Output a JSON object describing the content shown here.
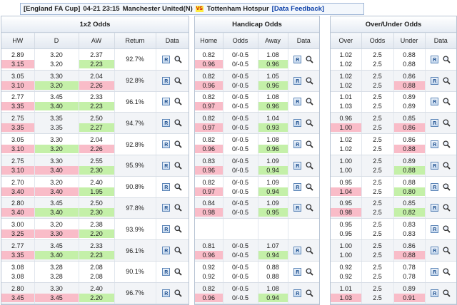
{
  "header": {
    "league": "[England FA Cup]",
    "datetime": "04-21 23:15",
    "home_team": "Manchester United(N)",
    "vs_label": "VS",
    "away_team": "Tottenham Hotspur",
    "feedback_link": "[Data Feedback]"
  },
  "panels": {
    "odds_1x2": {
      "title": "1x2 Odds",
      "columns": [
        "HW",
        "D",
        "AW",
        "Return",
        "Data"
      ],
      "rows": [
        {
          "hw": [
            "2.89",
            "3.15"
          ],
          "d": [
            "3.20",
            "3.20"
          ],
          "aw": [
            "2.37",
            "2.23"
          ],
          "ret": "92.7%",
          "hl": [
            "up",
            "",
            "down"
          ]
        },
        {
          "hw": [
            "3.05",
            "3.10"
          ],
          "d": [
            "3.30",
            "3.20"
          ],
          "aw": [
            "2.04",
            "2.26"
          ],
          "ret": "92.8%",
          "hl": [
            "up",
            "down",
            "up"
          ]
        },
        {
          "hw": [
            "2.77",
            "3.35"
          ],
          "d": [
            "3.45",
            "3.40"
          ],
          "aw": [
            "2.33",
            "2.23"
          ],
          "ret": "96.1%",
          "hl": [
            "up",
            "down",
            "down"
          ]
        },
        {
          "hw": [
            "2.75",
            "3.35"
          ],
          "d": [
            "3.35",
            "3.35"
          ],
          "aw": [
            "2.50",
            "2.27"
          ],
          "ret": "94.7%",
          "hl": [
            "up",
            "",
            "down"
          ]
        },
        {
          "hw": [
            "3.05",
            "3.10"
          ],
          "d": [
            "3.30",
            "3.20"
          ],
          "aw": [
            "2.04",
            "2.26"
          ],
          "ret": "92.8%",
          "hl": [
            "up",
            "down",
            "up"
          ]
        },
        {
          "hw": [
            "2.75",
            "3.10"
          ],
          "d": [
            "3.30",
            "3.40"
          ],
          "aw": [
            "2.55",
            "2.30"
          ],
          "ret": "95.9%",
          "hl": [
            "up",
            "up",
            "down"
          ]
        },
        {
          "hw": [
            "2.70",
            "3.40"
          ],
          "d": [
            "3.20",
            "3.40"
          ],
          "aw": [
            "2.40",
            "1.95"
          ],
          "ret": "90.8%",
          "hl": [
            "up",
            "up",
            "down"
          ]
        },
        {
          "hw": [
            "2.80",
            "3.40"
          ],
          "d": [
            "3.45",
            "3.40"
          ],
          "aw": [
            "2.50",
            "2.30"
          ],
          "ret": "97.8%",
          "hl": [
            "up",
            "down",
            "down"
          ]
        },
        {
          "hw": [
            "3.00",
            "3.25"
          ],
          "d": [
            "3.20",
            "3.30"
          ],
          "aw": [
            "2.38",
            "2.20"
          ],
          "ret": "93.9%",
          "hl": [
            "up",
            "up",
            "down"
          ]
        },
        {
          "hw": [
            "2.77",
            "3.35"
          ],
          "d": [
            "3.45",
            "3.40"
          ],
          "aw": [
            "2.33",
            "2.23"
          ],
          "ret": "96.1%",
          "hl": [
            "up",
            "down",
            "down"
          ]
        },
        {
          "hw": [
            "3.08",
            "3.08"
          ],
          "d": [
            "3.28",
            "3.28"
          ],
          "aw": [
            "2.08",
            "2.08"
          ],
          "ret": "90.1%",
          "hl": [
            "",
            "",
            ""
          ]
        },
        {
          "hw": [
            "2.80",
            "3.45"
          ],
          "d": [
            "3.30",
            "3.45"
          ],
          "aw": [
            "2.40",
            "2.20"
          ],
          "ret": "96.7%",
          "hl": [
            "up",
            "up",
            "down"
          ]
        }
      ]
    },
    "handicap": {
      "title": "Handicap Odds",
      "columns": [
        "Home",
        "Odds",
        "Away",
        "Data"
      ],
      "rows": [
        {
          "home": [
            "0.82",
            "0.96"
          ],
          "odds": [
            "0/-0.5",
            "0/-0.5"
          ],
          "away": [
            "1.08",
            "0.96"
          ],
          "hl": [
            "up",
            "down"
          ],
          "empty": false
        },
        {
          "home": [
            "0.82",
            "0.96"
          ],
          "odds": [
            "0/-0.5",
            "0/-0.5"
          ],
          "away": [
            "1.05",
            "0.96"
          ],
          "hl": [
            "up",
            "down"
          ],
          "empty": false
        },
        {
          "home": [
            "0.82",
            "0.97"
          ],
          "odds": [
            "0/-0.5",
            "0/-0.5"
          ],
          "away": [
            "1.08",
            "0.96"
          ],
          "hl": [
            "up",
            "down"
          ],
          "empty": false
        },
        {
          "home": [
            "0.82",
            "0.97"
          ],
          "odds": [
            "0/-0.5",
            "0/-0.5"
          ],
          "away": [
            "1.04",
            "0.93"
          ],
          "hl": [
            "up",
            "down"
          ],
          "empty": false
        },
        {
          "home": [
            "0.82",
            "0.96"
          ],
          "odds": [
            "0/-0.5",
            "0/-0.5"
          ],
          "away": [
            "1.08",
            "0.96"
          ],
          "hl": [
            "up",
            "down"
          ],
          "empty": false
        },
        {
          "home": [
            "0.83",
            "0.96"
          ],
          "odds": [
            "0/-0.5",
            "0/-0.5"
          ],
          "away": [
            "1.09",
            "0.94"
          ],
          "hl": [
            "up",
            "down"
          ],
          "empty": false
        },
        {
          "home": [
            "0.82",
            "0.97"
          ],
          "odds": [
            "0/-0.5",
            "0/-0.5"
          ],
          "away": [
            "1.09",
            "0.94"
          ],
          "hl": [
            "up",
            "down"
          ],
          "empty": false
        },
        {
          "home": [
            "0.84",
            "0.98"
          ],
          "odds": [
            "0/-0.5",
            "0/-0.5"
          ],
          "away": [
            "1.09",
            "0.95"
          ],
          "hl": [
            "up",
            "down"
          ],
          "empty": false
        },
        {
          "home": [
            "",
            ""
          ],
          "odds": [
            "",
            ""
          ],
          "away": [
            "",
            ""
          ],
          "hl": [
            "",
            ""
          ],
          "empty": true
        },
        {
          "home": [
            "0.81",
            "0.96"
          ],
          "odds": [
            "0/-0.5",
            "0/-0.5"
          ],
          "away": [
            "1.07",
            "0.94"
          ],
          "hl": [
            "up",
            "down"
          ],
          "empty": false
        },
        {
          "home": [
            "0.92",
            "0.92"
          ],
          "odds": [
            "0/-0.5",
            "0/-0.5"
          ],
          "away": [
            "0.88",
            "0.88"
          ],
          "hl": [
            "",
            ""
          ],
          "empty": false
        },
        {
          "home": [
            "0.82",
            "0.96"
          ],
          "odds": [
            "0/-0.5",
            "0/-0.5"
          ],
          "away": [
            "1.08",
            "0.94"
          ],
          "hl": [
            "up",
            "down"
          ],
          "empty": false
        }
      ]
    },
    "over_under": {
      "title": "Over/Under Odds",
      "columns": [
        "Over",
        "Odds",
        "Under",
        "Data"
      ],
      "rows": [
        {
          "over": [
            "1.02",
            "1.02"
          ],
          "odds": [
            "2.5",
            "2.5"
          ],
          "under": [
            "0.88",
            "0.88"
          ],
          "hl": [
            "",
            ""
          ]
        },
        {
          "over": [
            "1.02",
            "1.02"
          ],
          "odds": [
            "2.5",
            "2.5"
          ],
          "under": [
            "0.86",
            "0.88"
          ],
          "hl": [
            "",
            "up"
          ]
        },
        {
          "over": [
            "1.01",
            "1.03"
          ],
          "odds": [
            "2.5",
            "2.5"
          ],
          "under": [
            "0.89",
            "0.89"
          ],
          "hl": [
            "",
            ""
          ]
        },
        {
          "over": [
            "0.96",
            "1.00"
          ],
          "odds": [
            "2.5",
            "2.5"
          ],
          "under": [
            "0.85",
            "0.86"
          ],
          "hl": [
            "up",
            "up"
          ]
        },
        {
          "over": [
            "1.02",
            "1.02"
          ],
          "odds": [
            "2.5",
            "2.5"
          ],
          "under": [
            "0.86",
            "0.88"
          ],
          "hl": [
            "",
            "up"
          ]
        },
        {
          "over": [
            "1.00",
            "1.00"
          ],
          "odds": [
            "2.5",
            "2.5"
          ],
          "under": [
            "0.89",
            "0.88"
          ],
          "hl": [
            "",
            "down"
          ]
        },
        {
          "over": [
            "0.95",
            "1.04"
          ],
          "odds": [
            "2.5",
            "2.5"
          ],
          "under": [
            "0.88",
            "0.80"
          ],
          "hl": [
            "up",
            "down"
          ]
        },
        {
          "over": [
            "0.95",
            "0.98"
          ],
          "odds": [
            "2.5",
            "2.5"
          ],
          "under": [
            "0.85",
            "0.82"
          ],
          "hl": [
            "up",
            "down"
          ]
        },
        {
          "over": [
            "0.95",
            "0.95"
          ],
          "odds": [
            "2.5",
            "2.5"
          ],
          "under": [
            "0.83",
            "0.83"
          ],
          "hl": [
            "",
            ""
          ]
        },
        {
          "over": [
            "1.00",
            "1.00"
          ],
          "odds": [
            "2.5",
            "2.5"
          ],
          "under": [
            "0.86",
            "0.88"
          ],
          "hl": [
            "",
            "up"
          ]
        },
        {
          "over": [
            "0.92",
            "0.92"
          ],
          "odds": [
            "2.5",
            "2.5"
          ],
          "under": [
            "0.78",
            "0.78"
          ],
          "hl": [
            "",
            ""
          ]
        },
        {
          "over": [
            "1.01",
            "1.03"
          ],
          "odds": [
            "2.5",
            "2.5"
          ],
          "under": [
            "0.89",
            "0.91"
          ],
          "hl": [
            "up",
            "up"
          ]
        }
      ]
    }
  },
  "icons": {
    "analysis": "R",
    "search": "magnifier-icon"
  },
  "colors": {
    "up": "#f9bcc8",
    "down": "#c4f0a8",
    "link": "#0b3fa8"
  }
}
